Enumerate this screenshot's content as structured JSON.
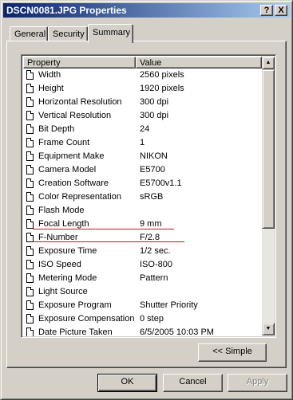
{
  "window": {
    "title": "DSCN0081.JPG Properties",
    "help_glyph": "?",
    "close_glyph": "X"
  },
  "tabs": [
    {
      "label": "General"
    },
    {
      "label": "Security"
    },
    {
      "label": "Summary",
      "selected": true
    }
  ],
  "list": {
    "columns": [
      "Property",
      "Value"
    ],
    "rows": [
      {
        "property": "Width",
        "value": "2560 pixels"
      },
      {
        "property": "Height",
        "value": "1920 pixels"
      },
      {
        "property": "Horizontal Resolution",
        "value": "300 dpi"
      },
      {
        "property": "Vertical Resolution",
        "value": "300 dpi"
      },
      {
        "property": "Bit Depth",
        "value": "24"
      },
      {
        "property": "Frame Count",
        "value": "1"
      },
      {
        "property": "Equipment Make",
        "value": "NIKON"
      },
      {
        "property": "Camera Model",
        "value": "E5700"
      },
      {
        "property": "Creation Software",
        "value": "E5700v1.1"
      },
      {
        "property": "Color Representation",
        "value": "sRGB"
      },
      {
        "property": "Flash Mode",
        "value": ""
      },
      {
        "property": "Focal Length",
        "value": "9 mm"
      },
      {
        "property": "F-Number",
        "value": "F/2.8"
      },
      {
        "property": "Exposure Time",
        "value": "1/2 sec."
      },
      {
        "property": "ISO Speed",
        "value": "ISO-800"
      },
      {
        "property": "Metering Mode",
        "value": "Pattern"
      },
      {
        "property": "Light Source",
        "value": ""
      },
      {
        "property": "Exposure Program",
        "value": "Shutter Priority"
      },
      {
        "property": "Exposure Compensation",
        "value": "0 step"
      },
      {
        "property": "Date Picture Taken",
        "value": "6/5/2005 10:03 PM"
      }
    ]
  },
  "buttons": {
    "simple": "<< Simple",
    "ok": "OK",
    "cancel": "Cancel",
    "apply": "Apply"
  },
  "annotation_color": "#c8102e"
}
